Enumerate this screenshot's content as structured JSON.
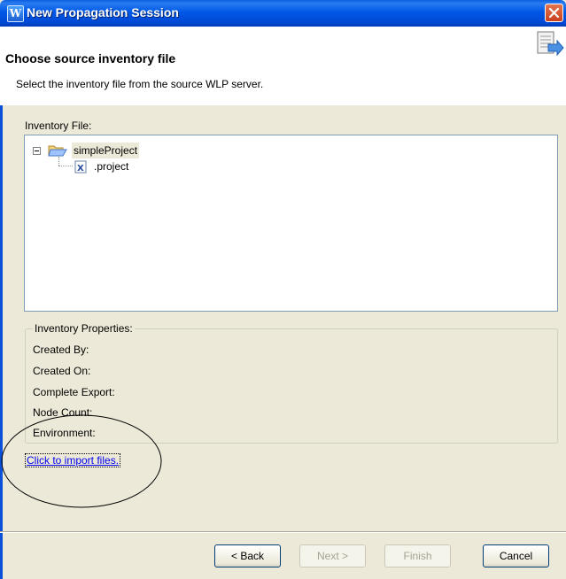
{
  "window": {
    "title": "New Propagation Session",
    "app_icon_glyph": "W"
  },
  "header": {
    "title": "Choose source inventory file",
    "description": "Select the inventory file from the source WLP server."
  },
  "inventory_file": {
    "label": "Inventory File:",
    "tree": {
      "root": {
        "label": "simpleProject",
        "icon": "folder-open-icon",
        "expanded": true
      },
      "children": [
        {
          "label": ".project",
          "icon": "xml-file-icon"
        }
      ]
    }
  },
  "inventory_properties": {
    "legend": "Inventory Properties:",
    "fields": [
      "Created By:",
      "Created On:",
      "Complete Export:",
      "Node Count:",
      "Environment:"
    ]
  },
  "import_link": "Click to import files.",
  "buttons": {
    "back": "< Back",
    "next": "Next >",
    "finish": "Finish",
    "cancel": "Cancel"
  },
  "colors": {
    "titlebar": "#0054e3",
    "dialog_bg": "#ece9d8",
    "link": "#0000ee",
    "close": "#d5512d"
  }
}
